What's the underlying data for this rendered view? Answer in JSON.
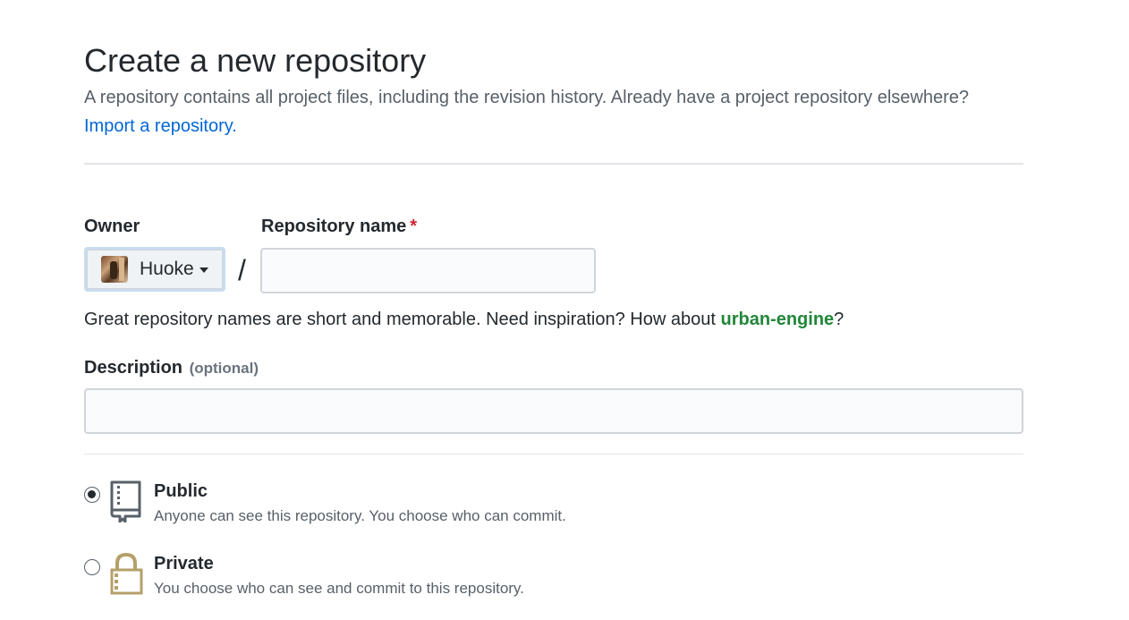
{
  "header": {
    "title": "Create a new repository",
    "subtitle": "A repository contains all project files, including the revision history. Already have a project repository elsewhere?",
    "import_link": "Import a repository."
  },
  "owner": {
    "label": "Owner",
    "selected": "Huoke",
    "avatar_icon": "user-avatar"
  },
  "separator": "/",
  "repository": {
    "label": "Repository name",
    "required_mark": "*",
    "value": "",
    "placeholder": ""
  },
  "name_hint": {
    "prefix": "Great repository names are short and memorable. Need inspiration? How about ",
    "suggestion": "urban-engine",
    "suffix": "?"
  },
  "description": {
    "label": "Description",
    "optional": "(optional)",
    "value": "",
    "placeholder": ""
  },
  "visibility": {
    "selected": "public",
    "options": [
      {
        "id": "public",
        "title": "Public",
        "description": "Anyone can see this repository. You choose who can commit.",
        "icon": "repo-book-icon"
      },
      {
        "id": "private",
        "title": "Private",
        "description": "You choose who can see and commit to this repository.",
        "icon": "lock-icon"
      }
    ]
  },
  "colors": {
    "link": "#0366d6",
    "suggestion": "#22863a",
    "required": "#cb2431",
    "lock_icon": "#b5a06a",
    "book_icon": "#586069"
  }
}
